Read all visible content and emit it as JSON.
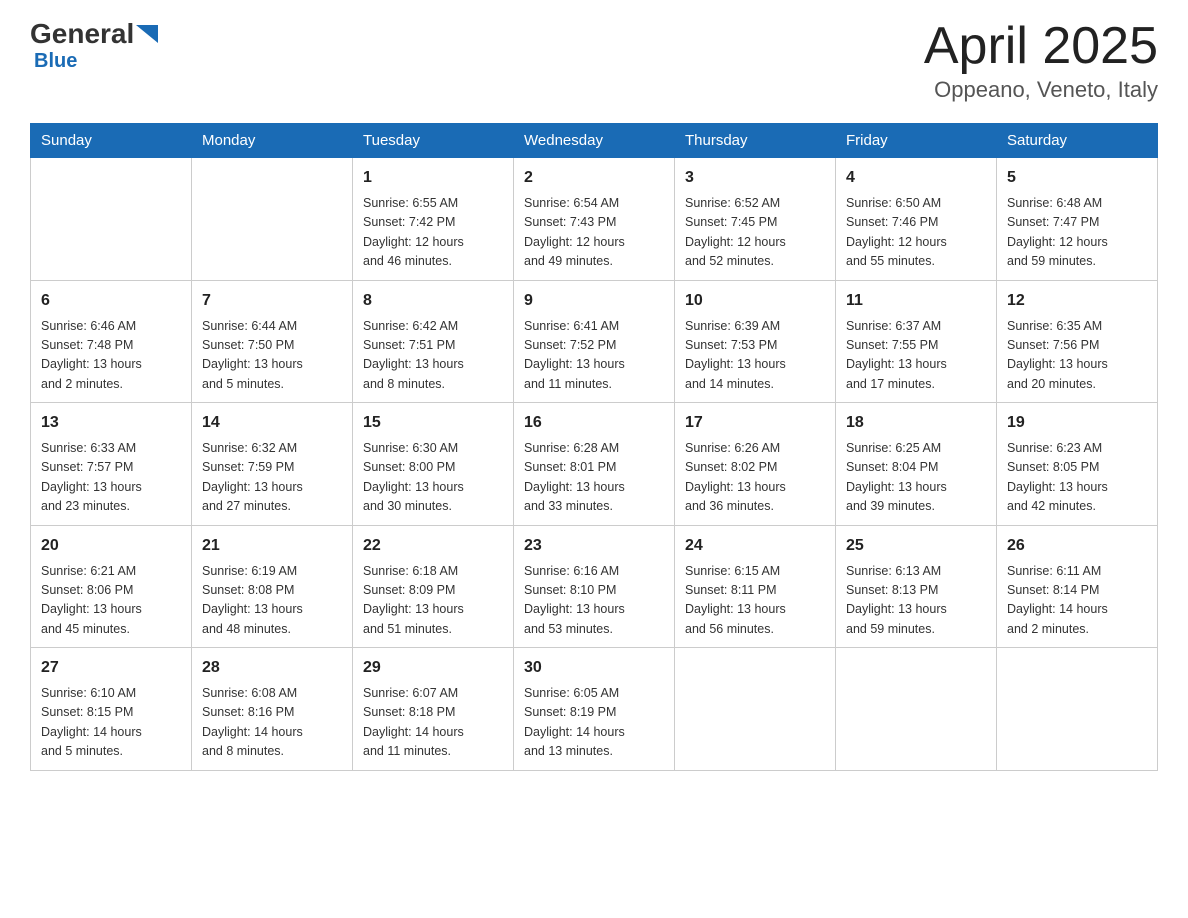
{
  "header": {
    "logo_general": "General",
    "logo_blue": "Blue",
    "month_title": "April 2025",
    "location": "Oppeano, Veneto, Italy"
  },
  "weekdays": [
    "Sunday",
    "Monday",
    "Tuesday",
    "Wednesday",
    "Thursday",
    "Friday",
    "Saturday"
  ],
  "weeks": [
    [
      {
        "day": "",
        "info": ""
      },
      {
        "day": "",
        "info": ""
      },
      {
        "day": "1",
        "info": "Sunrise: 6:55 AM\nSunset: 7:42 PM\nDaylight: 12 hours\nand 46 minutes."
      },
      {
        "day": "2",
        "info": "Sunrise: 6:54 AM\nSunset: 7:43 PM\nDaylight: 12 hours\nand 49 minutes."
      },
      {
        "day": "3",
        "info": "Sunrise: 6:52 AM\nSunset: 7:45 PM\nDaylight: 12 hours\nand 52 minutes."
      },
      {
        "day": "4",
        "info": "Sunrise: 6:50 AM\nSunset: 7:46 PM\nDaylight: 12 hours\nand 55 minutes."
      },
      {
        "day": "5",
        "info": "Sunrise: 6:48 AM\nSunset: 7:47 PM\nDaylight: 12 hours\nand 59 minutes."
      }
    ],
    [
      {
        "day": "6",
        "info": "Sunrise: 6:46 AM\nSunset: 7:48 PM\nDaylight: 13 hours\nand 2 minutes."
      },
      {
        "day": "7",
        "info": "Sunrise: 6:44 AM\nSunset: 7:50 PM\nDaylight: 13 hours\nand 5 minutes."
      },
      {
        "day": "8",
        "info": "Sunrise: 6:42 AM\nSunset: 7:51 PM\nDaylight: 13 hours\nand 8 minutes."
      },
      {
        "day": "9",
        "info": "Sunrise: 6:41 AM\nSunset: 7:52 PM\nDaylight: 13 hours\nand 11 minutes."
      },
      {
        "day": "10",
        "info": "Sunrise: 6:39 AM\nSunset: 7:53 PM\nDaylight: 13 hours\nand 14 minutes."
      },
      {
        "day": "11",
        "info": "Sunrise: 6:37 AM\nSunset: 7:55 PM\nDaylight: 13 hours\nand 17 minutes."
      },
      {
        "day": "12",
        "info": "Sunrise: 6:35 AM\nSunset: 7:56 PM\nDaylight: 13 hours\nand 20 minutes."
      }
    ],
    [
      {
        "day": "13",
        "info": "Sunrise: 6:33 AM\nSunset: 7:57 PM\nDaylight: 13 hours\nand 23 minutes."
      },
      {
        "day": "14",
        "info": "Sunrise: 6:32 AM\nSunset: 7:59 PM\nDaylight: 13 hours\nand 27 minutes."
      },
      {
        "day": "15",
        "info": "Sunrise: 6:30 AM\nSunset: 8:00 PM\nDaylight: 13 hours\nand 30 minutes."
      },
      {
        "day": "16",
        "info": "Sunrise: 6:28 AM\nSunset: 8:01 PM\nDaylight: 13 hours\nand 33 minutes."
      },
      {
        "day": "17",
        "info": "Sunrise: 6:26 AM\nSunset: 8:02 PM\nDaylight: 13 hours\nand 36 minutes."
      },
      {
        "day": "18",
        "info": "Sunrise: 6:25 AM\nSunset: 8:04 PM\nDaylight: 13 hours\nand 39 minutes."
      },
      {
        "day": "19",
        "info": "Sunrise: 6:23 AM\nSunset: 8:05 PM\nDaylight: 13 hours\nand 42 minutes."
      }
    ],
    [
      {
        "day": "20",
        "info": "Sunrise: 6:21 AM\nSunset: 8:06 PM\nDaylight: 13 hours\nand 45 minutes."
      },
      {
        "day": "21",
        "info": "Sunrise: 6:19 AM\nSunset: 8:08 PM\nDaylight: 13 hours\nand 48 minutes."
      },
      {
        "day": "22",
        "info": "Sunrise: 6:18 AM\nSunset: 8:09 PM\nDaylight: 13 hours\nand 51 minutes."
      },
      {
        "day": "23",
        "info": "Sunrise: 6:16 AM\nSunset: 8:10 PM\nDaylight: 13 hours\nand 53 minutes."
      },
      {
        "day": "24",
        "info": "Sunrise: 6:15 AM\nSunset: 8:11 PM\nDaylight: 13 hours\nand 56 minutes."
      },
      {
        "day": "25",
        "info": "Sunrise: 6:13 AM\nSunset: 8:13 PM\nDaylight: 13 hours\nand 59 minutes."
      },
      {
        "day": "26",
        "info": "Sunrise: 6:11 AM\nSunset: 8:14 PM\nDaylight: 14 hours\nand 2 minutes."
      }
    ],
    [
      {
        "day": "27",
        "info": "Sunrise: 6:10 AM\nSunset: 8:15 PM\nDaylight: 14 hours\nand 5 minutes."
      },
      {
        "day": "28",
        "info": "Sunrise: 6:08 AM\nSunset: 8:16 PM\nDaylight: 14 hours\nand 8 minutes."
      },
      {
        "day": "29",
        "info": "Sunrise: 6:07 AM\nSunset: 8:18 PM\nDaylight: 14 hours\nand 11 minutes."
      },
      {
        "day": "30",
        "info": "Sunrise: 6:05 AM\nSunset: 8:19 PM\nDaylight: 14 hours\nand 13 minutes."
      },
      {
        "day": "",
        "info": ""
      },
      {
        "day": "",
        "info": ""
      },
      {
        "day": "",
        "info": ""
      }
    ]
  ]
}
